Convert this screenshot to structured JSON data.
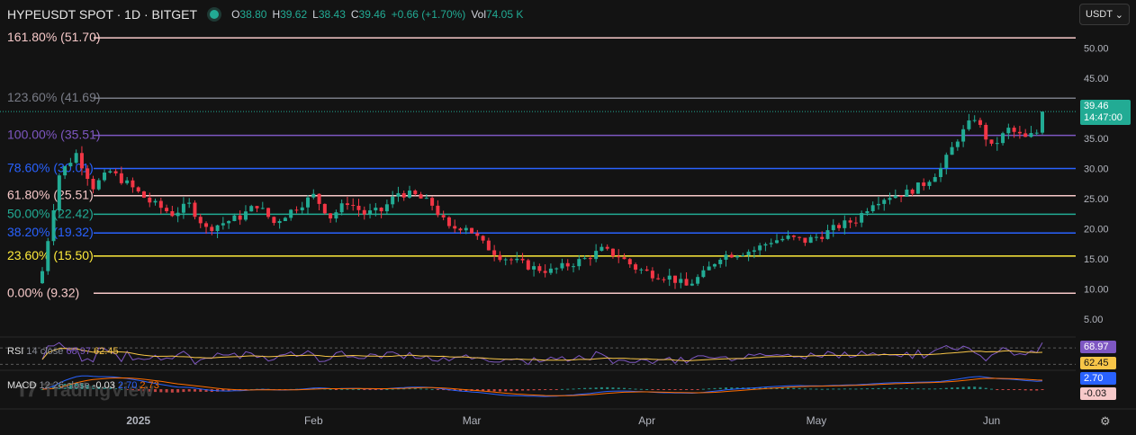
{
  "header": {
    "symbol": "HYPEUSDT SPOT · 1D · BITGET",
    "open_label": "O",
    "open": "38.80",
    "high_label": "H",
    "high": "39.62",
    "low_label": "L",
    "low": "38.43",
    "close_label": "C",
    "close": "39.46",
    "change": "+0.66 (+1.70%)",
    "volume_label": "Vol",
    "volume": "74.05 K"
  },
  "currency_button": {
    "label": "USDT",
    "icon": "chevron-down-icon"
  },
  "last_price": {
    "value": "39.46",
    "countdown": "14:47:00"
  },
  "rsi": {
    "label": "RSI",
    "params": "14 close",
    "value1": "68.97",
    "value2": "62.45"
  },
  "macd": {
    "label": "MACD",
    "params": "12 26 close",
    "hist": "-0.03",
    "macd": "2.70",
    "signal": "2.73"
  },
  "watermark": "TradingView",
  "colors": {
    "background": "#131313",
    "up": "#22ab94",
    "down": "#f23645",
    "rsi_line": "#7e57c2",
    "rsi_ma": "#f7c548",
    "macd_line": "#2962ff",
    "signal_line": "#ff6d00"
  },
  "chart_data": {
    "type": "candlestick",
    "title": "HYPEUSDT SPOT · 1D · BITGET",
    "y_ticks": [
      5,
      10,
      15,
      20,
      25,
      30,
      35,
      40,
      45,
      50
    ],
    "y_tick_labels": [
      "5.00",
      "10.00",
      "15.00",
      "20.00",
      "25.00",
      "30.00",
      "35.00",
      "40.00",
      "45.00",
      "50.00"
    ],
    "ylim": [
      2.5,
      53.5
    ],
    "x_tick_labels": [
      "2025",
      "Feb",
      "Mar",
      "Apr",
      "May",
      "Jun"
    ],
    "x_tick_dates": [
      "2025-01-01",
      "2025-02-01",
      "2025-03-01",
      "2025-04-01",
      "2025-05-01",
      "2025-06-01"
    ],
    "date_range": [
      "2024-12-15",
      "2025-06-10"
    ],
    "fib_levels": [
      {
        "label": "161.80% (51.70)",
        "value": 51.7,
        "color": "#f7c9c9"
      },
      {
        "label": "123.60% (41.69)",
        "value": 41.69,
        "color": "#787b86"
      },
      {
        "label": "100.00% (35.51)",
        "value": 35.51,
        "color": "#7e57c2"
      },
      {
        "label": "78.60% (30.01)",
        "value": 30.01,
        "color": "#2962ff"
      },
      {
        "label": "61.80% (25.51)",
        "value": 25.51,
        "color": "#f7c9c9"
      },
      {
        "label": "50.00% (22.42)",
        "value": 22.42,
        "color": "#22ab94"
      },
      {
        "label": "38.20% (19.32)",
        "value": 19.32,
        "color": "#2962ff"
      },
      {
        "label": "23.60% (15.50)",
        "value": 15.5,
        "color": "#ffeb3b"
      },
      {
        "label": "0.00% (9.32)",
        "value": 9.32,
        "color": "#f7c9c9"
      }
    ],
    "closes": [
      {
        "d": "2024-12-15",
        "c": 13.0
      },
      {
        "d": "2024-12-18",
        "c": 29.0
      },
      {
        "d": "2024-12-21",
        "c": 32.5
      },
      {
        "d": "2024-12-24",
        "c": 27.0
      },
      {
        "d": "2024-12-27",
        "c": 29.5
      },
      {
        "d": "2024-12-30",
        "c": 27.5
      },
      {
        "d": "2025-01-03",
        "c": 24.5
      },
      {
        "d": "2025-01-07",
        "c": 22.5
      },
      {
        "d": "2025-01-10",
        "c": 24.0
      },
      {
        "d": "2025-01-13",
        "c": 20.0
      },
      {
        "d": "2025-01-16",
        "c": 21.0
      },
      {
        "d": "2025-01-19",
        "c": 22.0
      },
      {
        "d": "2025-01-22",
        "c": 24.0
      },
      {
        "d": "2025-01-25",
        "c": 21.0
      },
      {
        "d": "2025-01-28",
        "c": 23.0
      },
      {
        "d": "2025-02-01",
        "c": 25.5
      },
      {
        "d": "2025-02-04",
        "c": 22.0
      },
      {
        "d": "2025-02-07",
        "c": 24.5
      },
      {
        "d": "2025-02-10",
        "c": 22.5
      },
      {
        "d": "2025-02-13",
        "c": 23.0
      },
      {
        "d": "2025-02-16",
        "c": 26.0
      },
      {
        "d": "2025-02-19",
        "c": 25.5
      },
      {
        "d": "2025-02-22",
        "c": 24.0
      },
      {
        "d": "2025-02-25",
        "c": 20.0
      },
      {
        "d": "2025-02-28",
        "c": 20.5
      },
      {
        "d": "2025-03-03",
        "c": 17.5
      },
      {
        "d": "2025-03-06",
        "c": 15.5
      },
      {
        "d": "2025-03-09",
        "c": 14.5
      },
      {
        "d": "2025-03-12",
        "c": 13.5
      },
      {
        "d": "2025-03-15",
        "c": 13.0
      },
      {
        "d": "2025-03-18",
        "c": 14.0
      },
      {
        "d": "2025-03-21",
        "c": 15.0
      },
      {
        "d": "2025-03-24",
        "c": 16.5
      },
      {
        "d": "2025-03-27",
        "c": 15.5
      },
      {
        "d": "2025-03-30",
        "c": 13.5
      },
      {
        "d": "2025-04-02",
        "c": 12.5
      },
      {
        "d": "2025-04-05",
        "c": 12.0
      },
      {
        "d": "2025-04-08",
        "c": 10.5
      },
      {
        "d": "2025-04-11",
        "c": 12.5
      },
      {
        "d": "2025-04-14",
        "c": 15.5
      },
      {
        "d": "2025-04-17",
        "c": 16.0
      },
      {
        "d": "2025-04-20",
        "c": 16.5
      },
      {
        "d": "2025-04-23",
        "c": 18.0
      },
      {
        "d": "2025-04-26",
        "c": 18.5
      },
      {
        "d": "2025-04-29",
        "c": 18.0
      },
      {
        "d": "2025-05-02",
        "c": 19.0
      },
      {
        "d": "2025-05-05",
        "c": 20.5
      },
      {
        "d": "2025-05-08",
        "c": 21.5
      },
      {
        "d": "2025-05-11",
        "c": 24.5
      },
      {
        "d": "2025-05-14",
        "c": 25.5
      },
      {
        "d": "2025-05-17",
        "c": 26.0
      },
      {
        "d": "2025-05-20",
        "c": 27.5
      },
      {
        "d": "2025-05-23",
        "c": 30.0
      },
      {
        "d": "2025-05-26",
        "c": 35.0
      },
      {
        "d": "2025-05-29",
        "c": 38.5
      },
      {
        "d": "2025-06-01",
        "c": 33.5
      },
      {
        "d": "2025-06-04",
        "c": 36.5
      },
      {
        "d": "2025-06-07",
        "c": 35.0
      },
      {
        "d": "2025-06-09",
        "c": 36.0
      },
      {
        "d": "2025-06-10",
        "c": 39.46
      }
    ]
  }
}
